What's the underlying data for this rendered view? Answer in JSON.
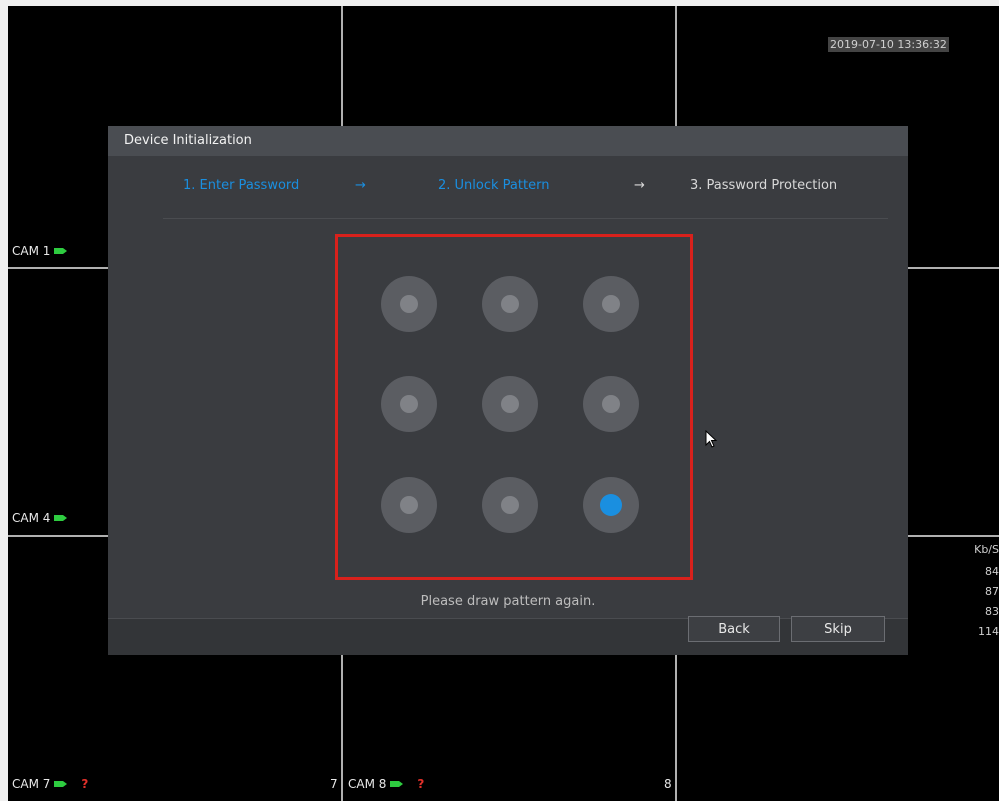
{
  "monitor": {
    "datetime": "2019-07-10 13:36:32",
    "cameras": [
      {
        "label": "CAM 1"
      },
      {
        "label": "CAM 4"
      },
      {
        "label": "CAM 7"
      },
      {
        "label": "CAM 8"
      }
    ],
    "channel_numbers": [
      "7",
      "8"
    ],
    "no_signal_mark": "?",
    "bitrate_label": "Kb/S",
    "bitrate_values": [
      "84",
      "87",
      "83",
      "114"
    ]
  },
  "dialog": {
    "title": "Device Initialization",
    "steps": [
      {
        "label": "1.  Enter Password",
        "state": "done"
      },
      {
        "label": "2.  Unlock Pattern",
        "state": "current"
      },
      {
        "label": "3.  Password Protection",
        "state": "pending"
      }
    ],
    "arrow": "→",
    "pattern": {
      "grid": "3x3",
      "selected_dots": [
        9
      ]
    },
    "hint": "Please draw pattern again.",
    "buttons": {
      "back": "Back",
      "skip": "Skip"
    }
  },
  "colors": {
    "accent": "#1a8fe0",
    "highlight_box": "#d8211c",
    "camera_icon": "#2ecc40",
    "no_signal": "#e0302a"
  }
}
